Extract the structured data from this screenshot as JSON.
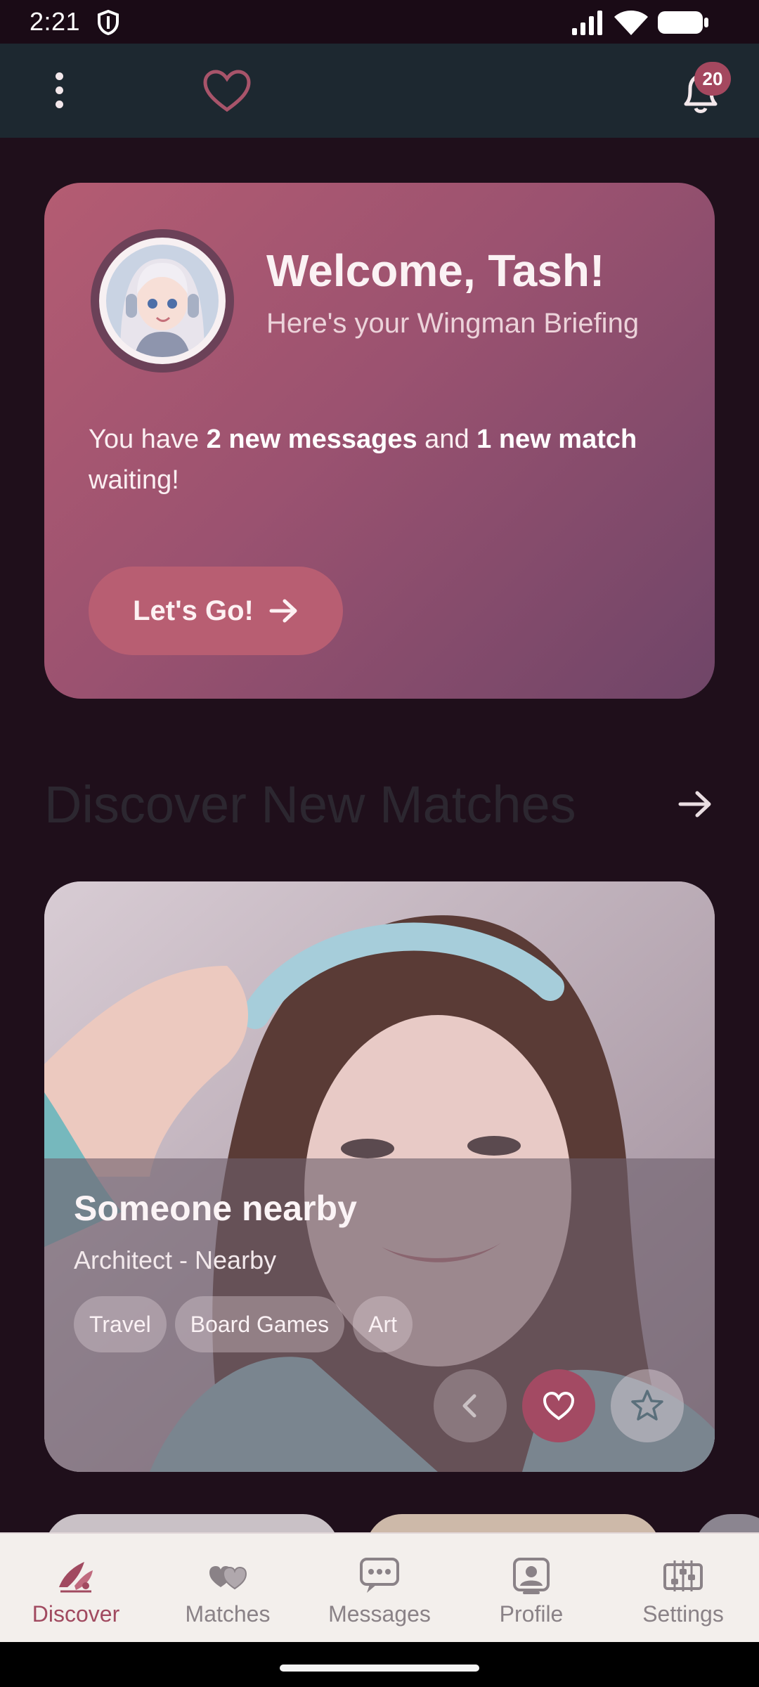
{
  "status_bar": {
    "time": "2:21"
  },
  "app_bar": {
    "notification_count": "20"
  },
  "welcome": {
    "title": "Welcome, Tash!",
    "subtitle": "Here's your Wingman Briefing",
    "msg_prefix": "You have ",
    "msg_messages": "2 new messages",
    "msg_middle": " and ",
    "msg_match": "1 new match",
    "msg_suffix": " waiting!",
    "cta_label": "Let's Go!"
  },
  "discover": {
    "title": "Discover New Matches"
  },
  "match_card": {
    "name": "Someone nearby",
    "subtitle": "Architect - Nearby",
    "tags": [
      "Travel",
      "Board Games",
      "Art"
    ]
  },
  "bottom_nav": {
    "items": [
      {
        "label": "Discover",
        "icon": "discover-icon",
        "active": true
      },
      {
        "label": "Matches",
        "icon": "matches-icon",
        "active": false
      },
      {
        "label": "Messages",
        "icon": "messages-icon",
        "active": false
      },
      {
        "label": "Profile",
        "icon": "profile-icon",
        "active": false
      },
      {
        "label": "Settings",
        "icon": "settings-icon",
        "active": false
      }
    ]
  },
  "colors": {
    "accent": "#a34a63",
    "background": "#1f0f1b",
    "app_bar": "#1d2830",
    "nav_background": "#f3efec"
  }
}
